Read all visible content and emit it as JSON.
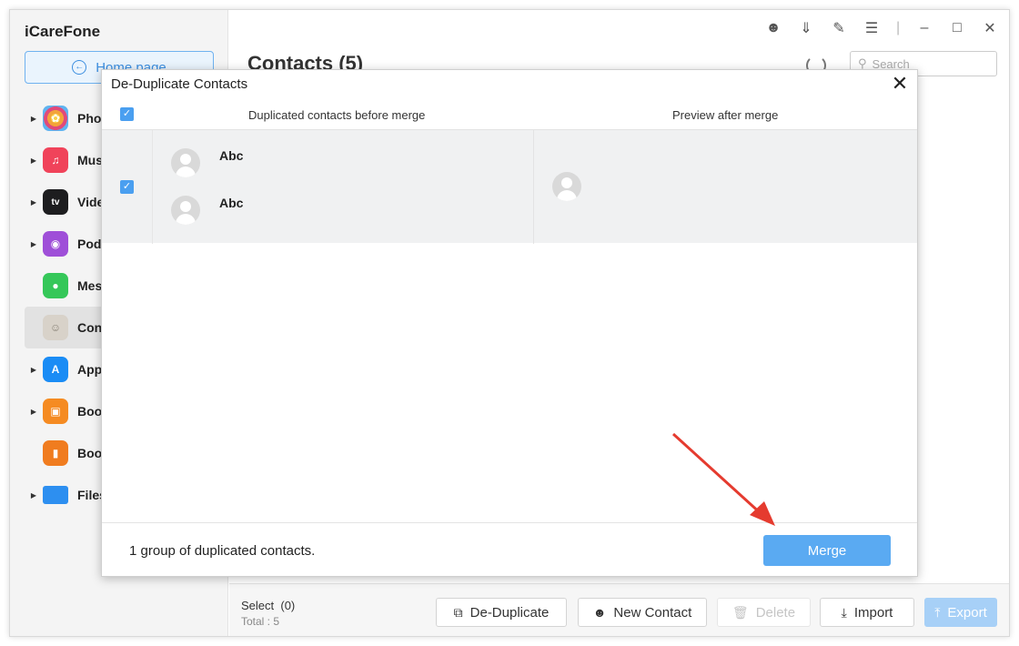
{
  "app": {
    "title": "iCareFone"
  },
  "sidebar": {
    "home_label": "Home page",
    "items": [
      {
        "label": "Pho",
        "icon": "photos-icon",
        "color": "#f3a33a",
        "expandable": true
      },
      {
        "label": "Mus",
        "icon": "music-icon",
        "color": "#f0435a",
        "expandable": true
      },
      {
        "label": "Vide",
        "icon": "tv-icon",
        "color": "#1d1d1f",
        "expandable": true
      },
      {
        "label": "Pod",
        "icon": "podcast-icon",
        "color": "#9f4fd8",
        "expandable": true
      },
      {
        "label": "Mes",
        "icon": "messages-icon",
        "color": "#35c759",
        "expandable": false
      },
      {
        "label": "Con",
        "icon": "contacts-icon",
        "color": "#c9c2b8",
        "expandable": false,
        "active": true
      },
      {
        "label": "App",
        "icon": "appstore-icon",
        "color": "#1a8cf5",
        "expandable": true
      },
      {
        "label": "Boo",
        "icon": "books-icon",
        "color": "#f58b22",
        "expandable": true
      },
      {
        "label": "Boo",
        "icon": "bookmark-icon",
        "color": "#f07c1f",
        "expandable": false
      },
      {
        "label": "Files",
        "icon": "folder-icon",
        "color": "#2d8ff0",
        "expandable": true
      }
    ]
  },
  "main": {
    "title": "Contacts (5)",
    "search_placeholder": "Search"
  },
  "statusbar": {
    "select_label": "Select",
    "select_count": "(0)",
    "total_label": "Total : 5",
    "buttons": {
      "deduplicate": "De-Duplicate",
      "new_contact": "New Contact",
      "delete": "Delete",
      "import": "Import",
      "export": "Export"
    }
  },
  "dialog": {
    "title": "De-Duplicate Contacts",
    "col_before": "Duplicated contacts before merge",
    "col_after": "Preview after merge",
    "group": {
      "contacts": [
        {
          "name": "Abc"
        },
        {
          "name": "Abc"
        }
      ]
    },
    "footer_text": "1 group of duplicated contacts.",
    "merge_label": "Merge"
  },
  "colors": {
    "accent": "#4a9ff0",
    "merge_button": "#5aaaf2",
    "arrow": "#e53b2f"
  }
}
